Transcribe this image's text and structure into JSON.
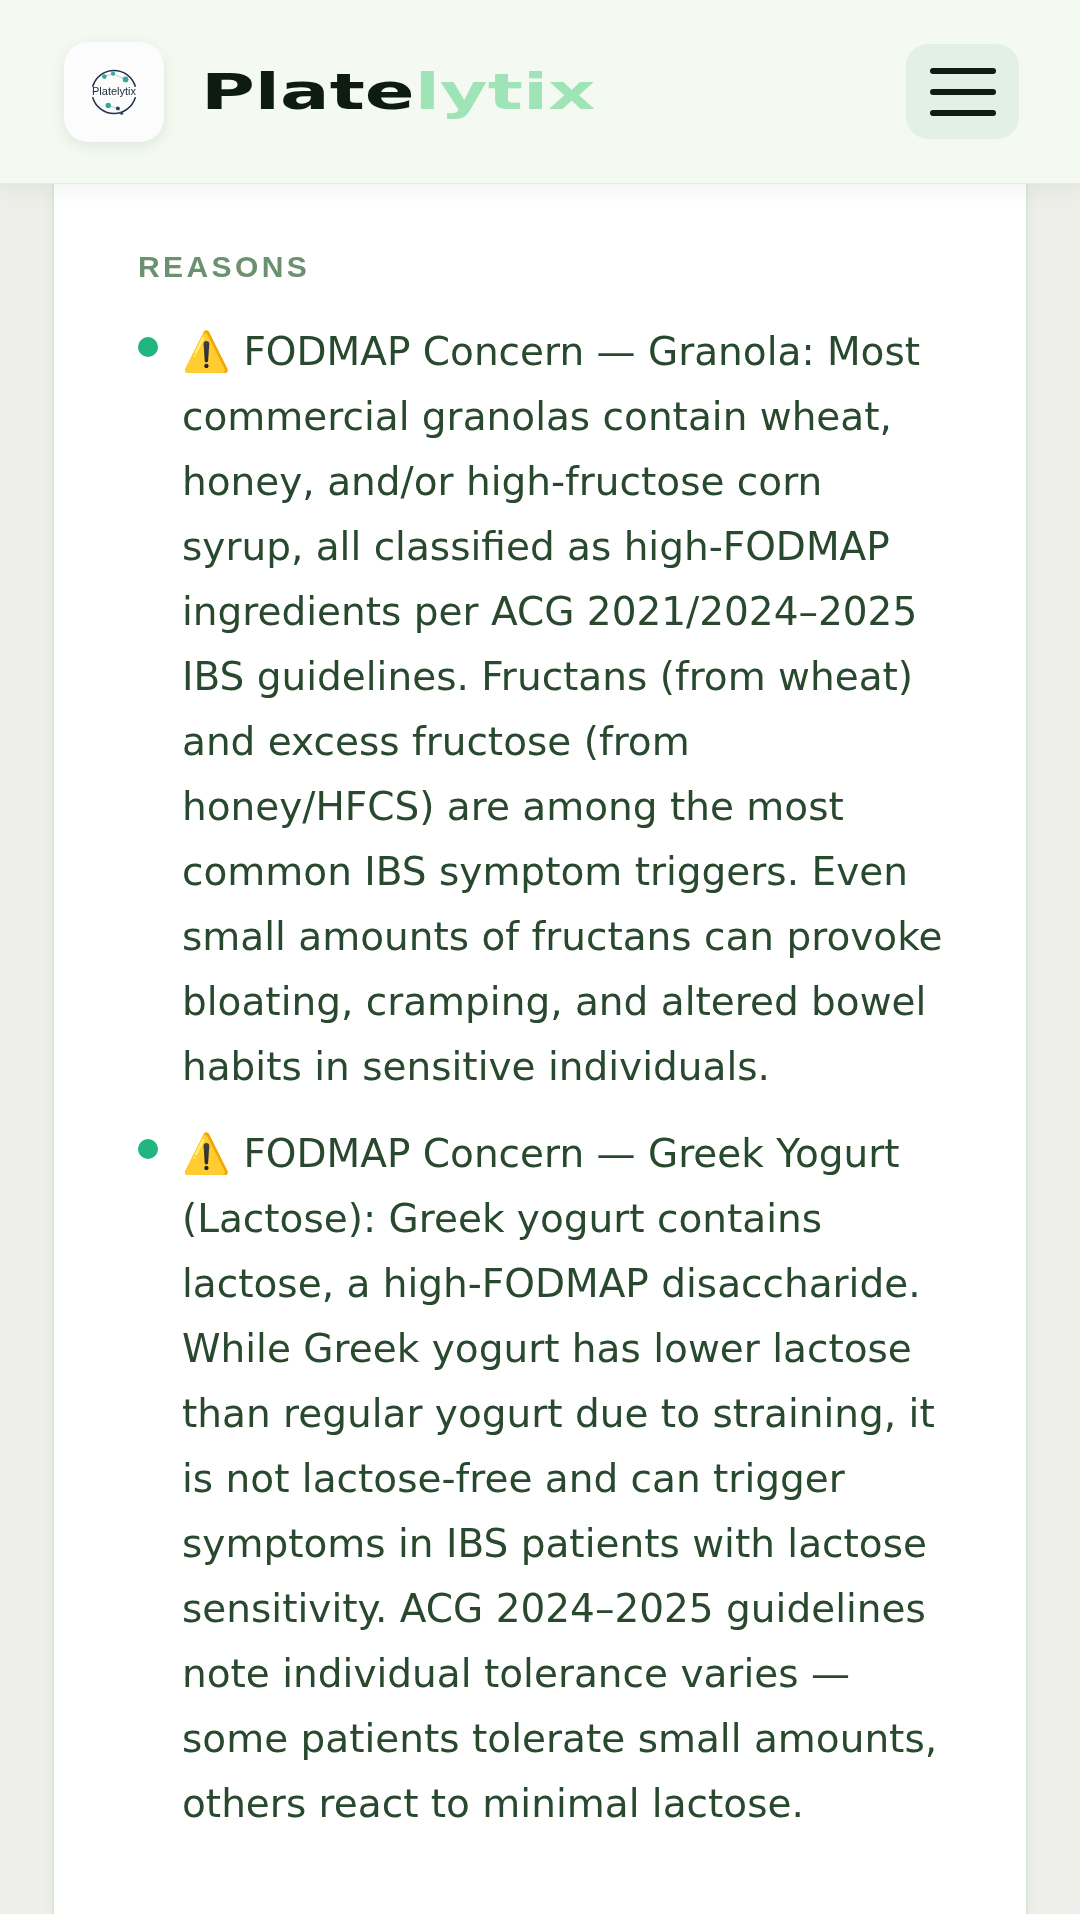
{
  "header": {
    "logo": {
      "text": "Platelytix"
    },
    "wordmark": [
      {
        "text": "Plate",
        "color": "#0d1c0f"
      },
      {
        "text": "lytix",
        "color": "#9ee4b7"
      }
    ]
  },
  "reasons": {
    "heading": "REASONS",
    "items": [
      {
        "text": "⚠️ FODMAP Concern — Granola: Most commercial granolas contain wheat, honey, and/or high-fructose corn syrup, all classified as high-FODMAP ingredients per ACG 2021/2024–2025 IBS guidelines. Fructans (from wheat) and excess fructose (from honey/HFCS) are among the most common IBS symptom triggers. Even small amounts of fructans can provoke bloating, cramping, and altered bowel habits in sensitive individuals."
      },
      {
        "text": "⚠️ FODMAP Concern — Greek Yogurt (Lactose): Greek yogurt contains lactose, a high-FODMAP disaccharide. While Greek yogurt has lower lactose than regular yogurt due to straining, it is not lactose-free and can trigger symptoms in IBS patients with lactose sensitivity. ACG 2024–2025 guidelines note individual tolerance varies — some patients tolerate small amounts, others react to minimal lactose."
      }
    ]
  }
}
